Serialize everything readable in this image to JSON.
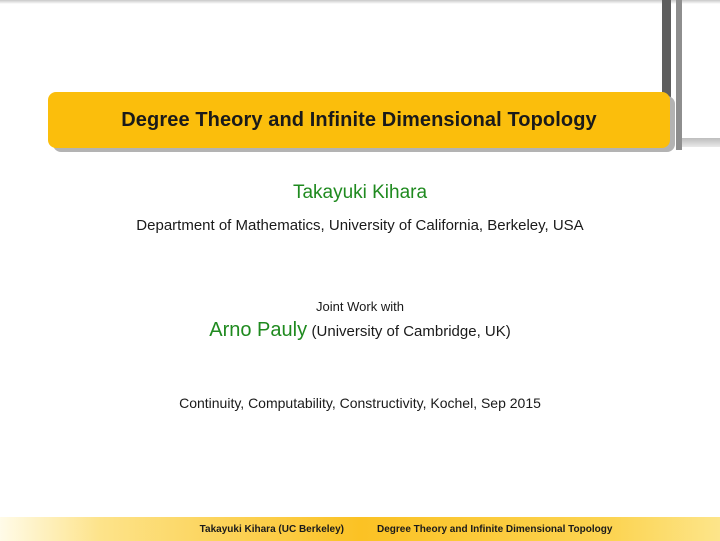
{
  "slide": {
    "title": "Degree Theory and Infinite Dimensional Topology",
    "author": "Takayuki Kihara",
    "affiliation": "Department of Mathematics, University of California, Berkeley, USA",
    "joint_label": "Joint Work with",
    "coauthor_name": "Arno Pauly",
    "coauthor_affiliation": "(University of Cambridge, UK)",
    "conference": "Continuity, Computability, Constructivity, Kochel, Sep 2015"
  },
  "footer": {
    "left": "Takayuki Kihara (UC Berkeley)",
    "right": "Degree Theory and Infinite Dimensional Topology"
  },
  "colors": {
    "accent": "#fbbe0c",
    "name_green": "#1f8a1f"
  }
}
